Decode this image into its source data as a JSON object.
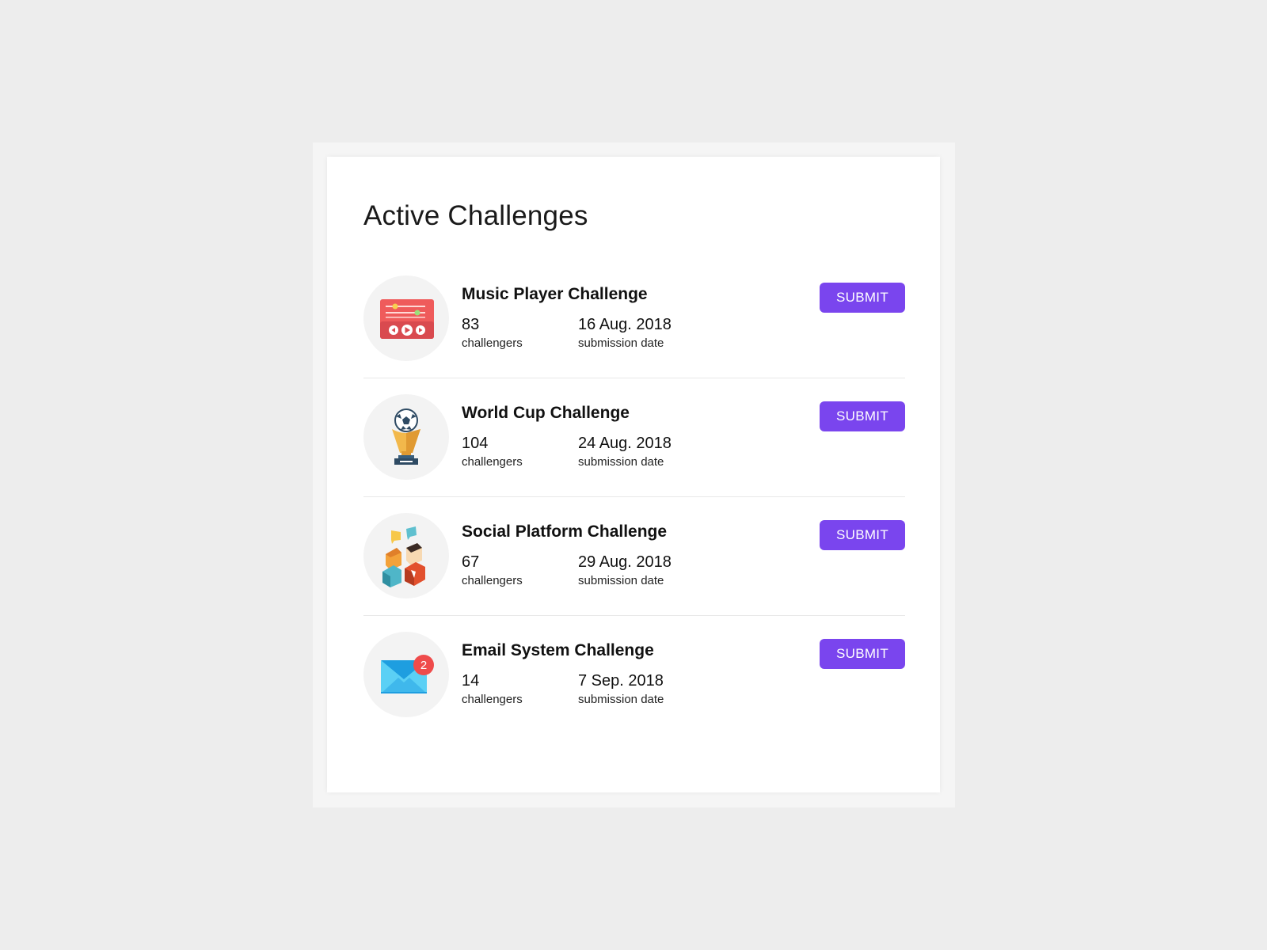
{
  "page": {
    "title": "Active Challenges"
  },
  "colors": {
    "background": "#ededed",
    "card": "#ffffff",
    "accent": "#7a45ee",
    "icon_circle": "#f3f3f3",
    "divider": "#e8e8e8"
  },
  "challenges": [
    {
      "name": "Music Player Challenge",
      "challengers": "83",
      "challengers_label": "challengers",
      "date": "16 Aug. 2018",
      "date_label": "submission date",
      "button": "SUBMIT",
      "icon": "music-player-icon"
    },
    {
      "name": "World Cup Challenge",
      "challengers": "104",
      "challengers_label": "challengers",
      "date": "24 Aug. 2018",
      "date_label": "submission date",
      "button": "SUBMIT",
      "icon": "trophy-icon"
    },
    {
      "name": "Social Platform Challenge",
      "challengers": "67",
      "challengers_label": "challengers",
      "date": "29 Aug. 2018",
      "date_label": "submission date",
      "button": "SUBMIT",
      "icon": "social-people-icon"
    },
    {
      "name": "Email System Challenge",
      "challengers": "14",
      "challengers_label": "challengers",
      "date": "7 Sep. 2018",
      "date_label": "submission date",
      "button": "SUBMIT",
      "icon": "email-icon",
      "icon_badge": "2"
    }
  ]
}
